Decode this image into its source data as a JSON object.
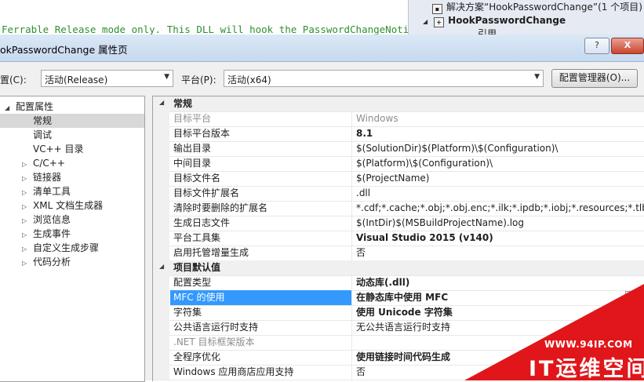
{
  "background": {
    "code_line": "Ferrable Release mode only. This DLL will hook the PasswordChangeNotify fu",
    "solution_explorer": {
      "solution": "解决方案“HookPasswordChange”(1 个项目)",
      "project": "HookPasswordChange",
      "references": "引用"
    }
  },
  "dialog": {
    "title": "okPasswordChange 属性页",
    "help_label": "?",
    "close_label": "X",
    "config_label": "置(C):",
    "config_value": "活动(Release)",
    "platform_label": "平台(P):",
    "platform_value": "活动(x64)",
    "config_manager_label": "配置管理器(O)..."
  },
  "tree": {
    "root": "配置属性",
    "items": [
      "常规",
      "调试",
      "VC++ 目录",
      "C/C++",
      "链接器",
      "清单工具",
      "XML 文档生成器",
      "浏览信息",
      "生成事件",
      "自定义生成步骤",
      "代码分析"
    ]
  },
  "grid": {
    "categories": [
      "常规",
      "项目默认值"
    ],
    "general": [
      {
        "name": "目标平台",
        "value": "Windows"
      },
      {
        "name": "目标平台版本",
        "value": "8.1"
      },
      {
        "name": "输出目录",
        "value": "$(SolutionDir)$(Platform)\\$(Configuration)\\"
      },
      {
        "name": "中间目录",
        "value": "$(Platform)\\$(Configuration)\\"
      },
      {
        "name": "目标文件名",
        "value": "$(ProjectName)"
      },
      {
        "name": "目标文件扩展名",
        "value": ".dll"
      },
      {
        "name": "清除时要删除的扩展名",
        "value": "*.cdf;*.cache;*.obj;*.obj.enc;*.ilk;*.ipdb;*.iobj;*.resources;*.tlb;*.tli;*.t"
      },
      {
        "name": "生成日志文件",
        "value": "$(IntDir)$(MSBuildProjectName).log"
      },
      {
        "name": "平台工具集",
        "value": "Visual Studio 2015 (v140)"
      },
      {
        "name": "启用托管增量生成",
        "value": "否"
      }
    ],
    "defaults": [
      {
        "name": "配置类型",
        "value": "动态库(.dll)"
      },
      {
        "name": "MFC 的使用",
        "value": "在静态库中使用 MFC"
      },
      {
        "name": "字符集",
        "value": "使用 Unicode 字符集"
      },
      {
        "name": "公共语言运行时支持",
        "value": "无公共语言运行时支持"
      },
      {
        "name": ".NET 目标框架版本",
        "value": ""
      },
      {
        "name": "全程序优化",
        "value": "使用链接时间代码生成"
      },
      {
        "name": "Windows 应用商店应用支持",
        "value": "否"
      }
    ]
  },
  "watermark": {
    "url": "WWW.94IP.COM",
    "brand": "IT运维空间",
    "color": "#e0161b"
  }
}
